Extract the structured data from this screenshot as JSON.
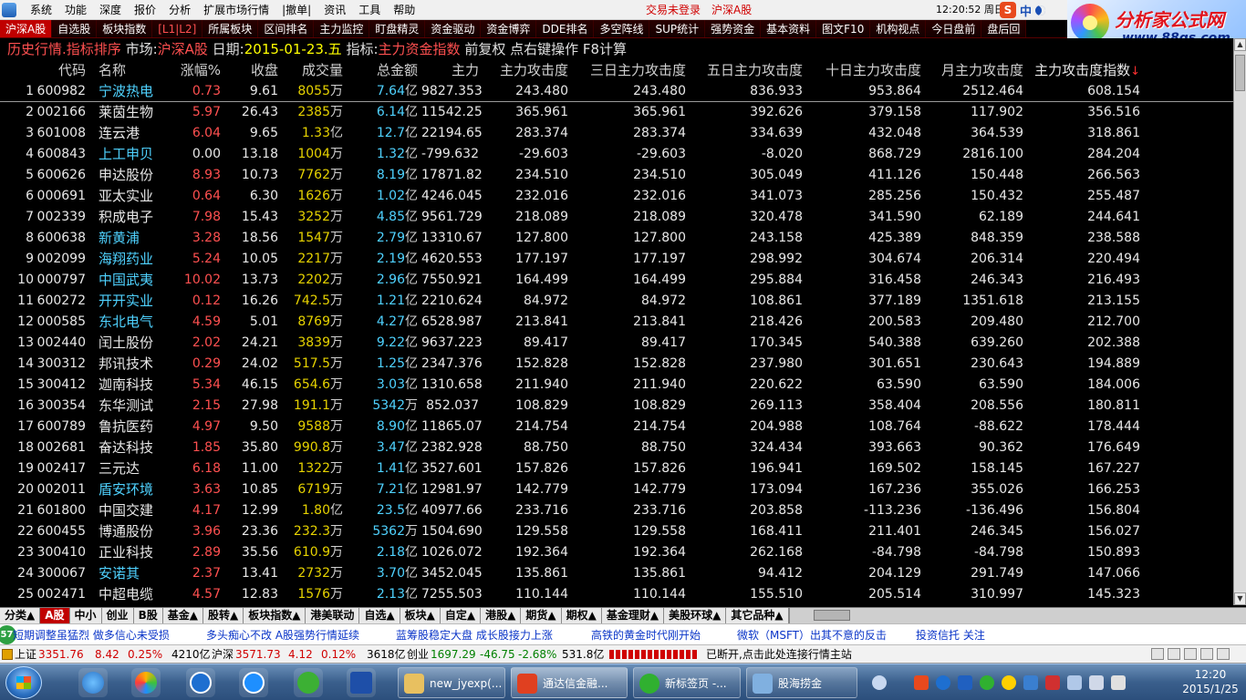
{
  "menubar": {
    "items": [
      "系统",
      "功能",
      "深度",
      "报价",
      "分析",
      "扩展市场行情",
      "|撤单|",
      "资讯",
      "工具",
      "帮助"
    ],
    "login_status": "交易未登录",
    "market": "沪深A股",
    "clock": "12:20:52 周日"
  },
  "ime": {
    "logo": "S",
    "lang": "中"
  },
  "logo": {
    "title": "分析家公式网",
    "url": "www.88gs.com"
  },
  "toolbar": {
    "tabs": [
      "沪深A股",
      "自选股",
      "板块指数",
      "[L1|L2]",
      "所属板块",
      "区间排名",
      "主力监控",
      "盯盘精灵",
      "资金驱动",
      "资金博弈",
      "DDE排名",
      "多空阵线",
      "SUP统计",
      "强势资金",
      "基本资料",
      "图文F10",
      "机构视点",
      "今日盘前",
      "盘后回"
    ]
  },
  "infoline": {
    "prefix": "历史行情.指标排序",
    "market_label": "市场:",
    "market_value": "沪深A股",
    "date_label": "日期:",
    "date_value": "2015-01-23.五",
    "indicator_label": "指标:",
    "indicator_value": "主力资金指数",
    "suffix": "前复权 点右键操作 F8计算"
  },
  "table": {
    "headers": [
      "",
      "代码",
      "名称",
      "涨幅%",
      "收盘",
      "成交量",
      "总金额",
      "主力",
      "主力攻击度",
      "三日主力攻击度",
      "五日主力攻击度",
      "十日主力攻击度",
      "月主力攻击度",
      "主力攻击度指数"
    ],
    "sort_arrow": "↓",
    "rows": [
      [
        "1",
        "600982",
        "宁波热电",
        "0.73",
        "9.61",
        "8055",
        "万",
        "7.64",
        "亿",
        "9827.353",
        "243.480",
        "243.480",
        "836.933",
        "953.864",
        "2512.464",
        "608.154"
      ],
      [
        "2",
        "002166",
        "莱茵生物",
        "5.97",
        "26.43",
        "2385",
        "万",
        "6.14",
        "亿",
        "11542.25",
        "365.961",
        "365.961",
        "392.626",
        "379.158",
        "117.902",
        "356.516"
      ],
      [
        "3",
        "601008",
        "连云港",
        "6.04",
        "9.65",
        "1.33",
        "亿",
        "12.7",
        "亿",
        "22194.65",
        "283.374",
        "283.374",
        "334.639",
        "432.048",
        "364.539",
        "318.861"
      ],
      [
        "4",
        "600843",
        "上工申贝",
        "0.00",
        "13.18",
        "1004",
        "万",
        "1.32",
        "亿",
        "-799.632",
        "-29.603",
        "-29.603",
        "-8.020",
        "868.729",
        "2816.100",
        "284.204"
      ],
      [
        "5",
        "600626",
        "申达股份",
        "8.93",
        "10.73",
        "7762",
        "万",
        "8.19",
        "亿",
        "17871.82",
        "234.510",
        "234.510",
        "305.049",
        "411.126",
        "150.448",
        "266.563"
      ],
      [
        "6",
        "000691",
        "亚太实业",
        "0.64",
        "6.30",
        "1626",
        "万",
        "1.02",
        "亿",
        "4246.045",
        "232.016",
        "232.016",
        "341.073",
        "285.256",
        "150.432",
        "255.487"
      ],
      [
        "7",
        "002339",
        "积成电子",
        "7.98",
        "15.43",
        "3252",
        "万",
        "4.85",
        "亿",
        "9561.729",
        "218.089",
        "218.089",
        "320.478",
        "341.590",
        "62.189",
        "244.641"
      ],
      [
        "8",
        "600638",
        "新黄浦",
        "3.28",
        "18.56",
        "1547",
        "万",
        "2.79",
        "亿",
        "13310.67",
        "127.800",
        "127.800",
        "243.158",
        "425.389",
        "848.359",
        "238.588"
      ],
      [
        "9",
        "002099",
        "海翔药业",
        "5.24",
        "10.05",
        "2217",
        "万",
        "2.19",
        "亿",
        "4620.553",
        "177.197",
        "177.197",
        "298.992",
        "304.674",
        "206.314",
        "220.494"
      ],
      [
        "10",
        "000797",
        "中国武夷",
        "10.02",
        "13.73",
        "2202",
        "万",
        "2.96",
        "亿",
        "7550.921",
        "164.499",
        "164.499",
        "295.884",
        "316.458",
        "246.343",
        "216.493"
      ],
      [
        "11",
        "600272",
        "开开实业",
        "0.12",
        "16.26",
        "742.5",
        "万",
        "1.21",
        "亿",
        "2210.624",
        "84.972",
        "84.972",
        "108.861",
        "377.189",
        "1351.618",
        "213.155"
      ],
      [
        "12",
        "000585",
        "东北电气",
        "4.59",
        "5.01",
        "8769",
        "万",
        "4.27",
        "亿",
        "6528.987",
        "213.841",
        "213.841",
        "218.426",
        "200.583",
        "209.480",
        "212.700"
      ],
      [
        "13",
        "002440",
        "闰土股份",
        "2.02",
        "24.21",
        "3839",
        "万",
        "9.22",
        "亿",
        "9637.223",
        "89.417",
        "89.417",
        "170.345",
        "540.388",
        "639.260",
        "202.388"
      ],
      [
        "14",
        "300312",
        "邦讯技术",
        "0.29",
        "24.02",
        "517.5",
        "万",
        "1.25",
        "亿",
        "2347.376",
        "152.828",
        "152.828",
        "237.980",
        "301.651",
        "230.643",
        "194.889"
      ],
      [
        "15",
        "300412",
        "迦南科技",
        "5.34",
        "46.15",
        "654.6",
        "万",
        "3.03",
        "亿",
        "1310.658",
        "211.940",
        "211.940",
        "220.622",
        "63.590",
        "63.590",
        "184.006"
      ],
      [
        "16",
        "300354",
        "东华测试",
        "2.15",
        "27.98",
        "191.1",
        "万",
        "5342",
        "万",
        "852.037",
        "108.829",
        "108.829",
        "269.113",
        "358.404",
        "208.556",
        "180.811"
      ],
      [
        "17",
        "600789",
        "鲁抗医药",
        "4.97",
        "9.50",
        "9588",
        "万",
        "8.90",
        "亿",
        "11865.07",
        "214.754",
        "214.754",
        "204.988",
        "108.764",
        "-88.622",
        "178.444"
      ],
      [
        "18",
        "002681",
        "奋达科技",
        "1.85",
        "35.80",
        "990.8",
        "万",
        "3.47",
        "亿",
        "2382.928",
        "88.750",
        "88.750",
        "324.434",
        "393.663",
        "90.362",
        "176.649"
      ],
      [
        "19",
        "002417",
        "三元达",
        "6.18",
        "11.00",
        "1322",
        "万",
        "1.41",
        "亿",
        "3527.601",
        "157.826",
        "157.826",
        "196.941",
        "169.502",
        "158.145",
        "167.227"
      ],
      [
        "20",
        "002011",
        "盾安环境",
        "3.63",
        "10.85",
        "6719",
        "万",
        "7.21",
        "亿",
        "12981.97",
        "142.779",
        "142.779",
        "173.094",
        "167.236",
        "355.026",
        "166.253"
      ],
      [
        "21",
        "601800",
        "中国交建",
        "4.17",
        "12.99",
        "1.80",
        "亿",
        "23.5",
        "亿",
        "40977.66",
        "233.716",
        "233.716",
        "203.858",
        "-113.236",
        "-136.496",
        "156.804"
      ],
      [
        "22",
        "600455",
        "博通股份",
        "3.96",
        "23.36",
        "232.3",
        "万",
        "5362",
        "万",
        "1504.690",
        "129.558",
        "129.558",
        "168.411",
        "211.401",
        "246.345",
        "156.027"
      ],
      [
        "23",
        "300410",
        "正业科技",
        "2.89",
        "35.56",
        "610.9",
        "万",
        "2.18",
        "亿",
        "1026.072",
        "192.364",
        "192.364",
        "262.168",
        "-84.798",
        "-84.798",
        "150.893"
      ],
      [
        "24",
        "300067",
        "安诺其",
        "2.37",
        "13.41",
        "2732",
        "万",
        "3.70",
        "亿",
        "3452.045",
        "135.861",
        "135.861",
        "94.412",
        "204.129",
        "291.749",
        "147.066"
      ],
      [
        "25",
        "002471",
        "中超电缆",
        "4.57",
        "12.83",
        "1576",
        "万",
        "2.13",
        "亿",
        "7255.503",
        "110.144",
        "110.144",
        "155.510",
        "205.514",
        "310.997",
        "145.323"
      ]
    ],
    "cyan_names": [
      "宁波热电",
      "上工申贝",
      "新黄浦",
      "海翔药业",
      "中国武夷",
      "开开实业",
      "东北电气",
      "盾安环境",
      "安诺其"
    ]
  },
  "cattabs": [
    "分类▲",
    "A股",
    "中小",
    "创业",
    "B股",
    "基金▲",
    "股转▲",
    "板块指数▲",
    "港美联动",
    "自选▲",
    "板块▲",
    "自定▲",
    "港股▲",
    "期货▲",
    "期权▲",
    "基金理财▲",
    "美股环球▲",
    "其它品种▲"
  ],
  "ticker": {
    "badge": "57",
    "news": [
      "短期调整虽猛烈 做多信心未受损",
      "多头痴心不改 A股强势行情延续",
      "蓝筹股稳定大盘 成长股接力上涨",
      "高铁的黄金时代刚开始",
      "微软（MSFT）出其不意的反击",
      "投资信托 关注"
    ]
  },
  "indexbar": {
    "sh_label": "上证",
    "sh_val": "3351.76",
    "sh_chg": "8.42",
    "sh_pct": "0.25%",
    "sh_amt": "4210亿",
    "hs_label": "沪深",
    "hs_val": "3571.73",
    "hs_chg": "4.12",
    "hs_pct": "0.12%",
    "hs_amt": "3618亿",
    "cy_label": "创业",
    "cy_val": "1697.29",
    "cy_chg": "-46.75",
    "cy_pct": "-2.68%",
    "cy_amt": "531.8亿",
    "status": "已断开,点击此处连接行情主站"
  },
  "taskbar": {
    "tasks": [
      "new_jyexp(...",
      "通达信金融...",
      "新标签页 -...",
      "股海捞金"
    ],
    "clock_time": "12:20",
    "clock_date": "2015/1/25"
  },
  "colors": {
    "up": "#ff5050",
    "cyan": "#4fd2ff",
    "volume": "#e6d200",
    "accent_red": "#c00000"
  }
}
